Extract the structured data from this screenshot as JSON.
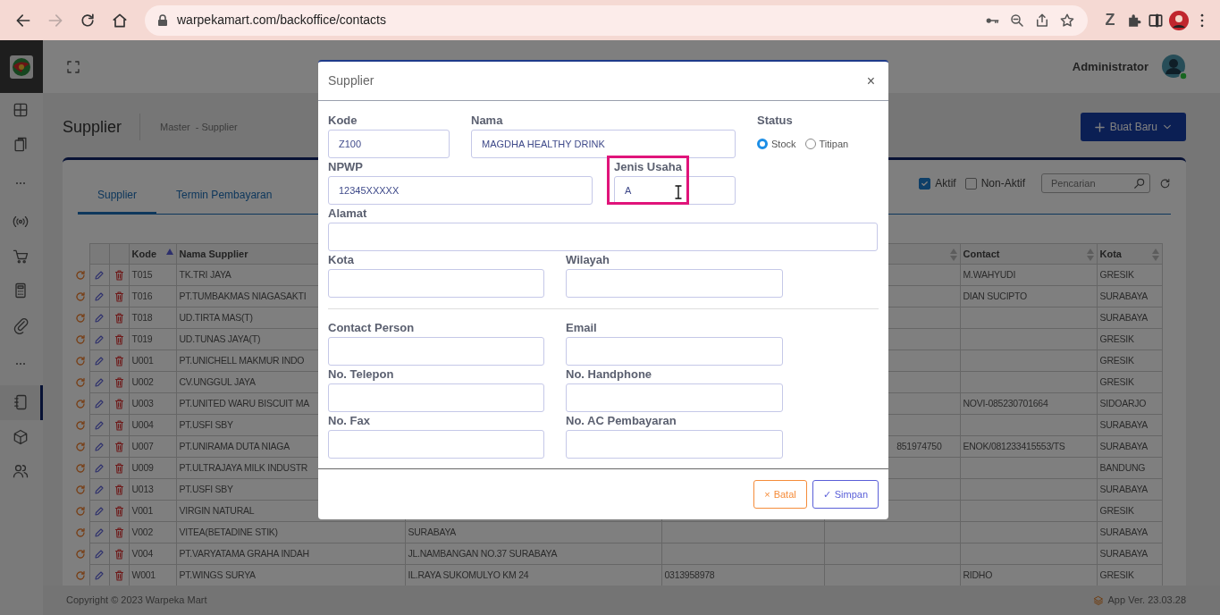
{
  "browser": {
    "nav_buttons": [
      {
        "kind": "back",
        "disabled": false
      },
      {
        "kind": "forward",
        "disabled": true
      },
      {
        "kind": "reload",
        "disabled": false
      },
      {
        "kind": "home",
        "disabled": false
      }
    ],
    "url": "warpekamart.com/backoffice/contacts",
    "extension_label": "Z"
  },
  "sidebar": {
    "items": [
      {
        "kind": "icon",
        "selected": false
      },
      {
        "kind": "icon",
        "selected": false
      },
      {
        "kind": "dots"
      },
      {
        "kind": "icon",
        "selected": false
      },
      {
        "kind": "icon",
        "selected": false
      },
      {
        "kind": "icon",
        "selected": false
      },
      {
        "kind": "icon",
        "selected": false
      },
      {
        "kind": "dots"
      },
      {
        "kind": "icon",
        "selected": true
      },
      {
        "kind": "icon",
        "selected": false
      },
      {
        "kind": "icon",
        "selected": false
      }
    ]
  },
  "header": {
    "user": "Administrator"
  },
  "page": {
    "title": "Supplier",
    "breadcrumb": [
      "Master",
      "-  Supplier"
    ],
    "new_button": "Buat Baru"
  },
  "tabs": [
    {
      "label": "Supplier",
      "selected": true
    },
    {
      "label": "Termin Pembayaran",
      "selected": false
    }
  ],
  "filters": [
    {
      "label": "Aktif",
      "checked": true
    },
    {
      "label": "Non-Aktif",
      "checked": false
    }
  ],
  "search": {
    "placeholder": "Pencarian"
  },
  "table": {
    "columns": [
      {
        "label": "Kode",
        "sortable": true,
        "sorted_ascending": true
      },
      {
        "label": "Nama Supplier"
      },
      {},
      {},
      {
        "sortable": true,
        "sorted_ascending": false
      },
      {
        "label": "Contact",
        "sortable": true,
        "sorted_ascending": false
      },
      {
        "label": "Kota",
        "sortable": true,
        "sorted_ascending": false
      }
    ],
    "rows": [
      {
        "kode": "T015",
        "nama": "TK.TRI JAYA",
        "contact": "M.WAHYUDI",
        "kota": "GRESIK"
      },
      {
        "kode": "T016",
        "nama": "PT.TUMBAKMAS NIAGASAKTI",
        "contact": "DIAN SUCIPTO",
        "kota": "SURABAYA"
      },
      {
        "kode": "T018",
        "nama": "UD.TIRTA MAS(T)",
        "kota": "SURABAYA"
      },
      {
        "kode": "T019",
        "nama": "UD.TUNAS JAYA(T)",
        "kota": "GRESIK"
      },
      {
        "kode": "U001",
        "nama": "PT.UNICHELL MAKMUR INDO",
        "kota": "GRESIK"
      },
      {
        "kode": "U002",
        "nama": "CV.UNGGUL JAYA",
        "kota": "GRESIK"
      },
      {
        "kode": "U003",
        "nama": "PT.UNITED WARU BISCUIT MA",
        "contact": "NOVI-085230701664",
        "kota": "SIDOARJO"
      },
      {
        "kode": "U004",
        "nama": "PT.USFI SBY",
        "kota": "SURABAYA"
      },
      {
        "kode": "U007",
        "nama": "PT.UNIRAMA DUTA NIAGA",
        "column_5": "851974750",
        "contact": "ENOK/081233415553/TS",
        "kota": "SURABAYA"
      },
      {
        "kode": "U009",
        "nama": "PT.ULTRAJAYA MILK INDUSTR",
        "kota": "BANDUNG"
      },
      {
        "kode": "U013",
        "nama": "PT.USFI SBY",
        "kota": "SURABAYA"
      },
      {
        "kode": "V001",
        "nama": "VIRGIN NATURAL",
        "kota": "GRESIK"
      },
      {
        "kode": "V002",
        "nama": "VITEA(BETADINE STIK)",
        "column_3": "SURABAYA",
        "kota": "SURABAYA"
      },
      {
        "kode": "V004",
        "nama": "PT.VARYATAMA GRAHA INDAH",
        "column_3": "JL.NAMBANGAN NO.37 SURABAYA",
        "kota": "SURABAYA"
      },
      {
        "kode": "W001",
        "nama": "PT.WINGS SURYA",
        "column_3": "IL.RAYA SUKOMULYO KM 24",
        "column_4": "0313958978",
        "contact": "RIDHO",
        "kota": "GRESIK"
      }
    ]
  },
  "footer": {
    "copyright": "Copyright © 2023 Warpeka Mart",
    "version": "App Ver. 23.03.28"
  },
  "modal": {
    "title": "Supplier",
    "close": "×",
    "sections": [
      [
        {
          "kind": "text",
          "label": "Kode",
          "value": "Z100",
          "highlighted": false,
          "hover": false
        },
        {
          "kind": "text",
          "label": "Nama",
          "value": "MAGDHA HEALTHY DRINK",
          "highlighted": false,
          "hover": false
        },
        {
          "kind": "radio",
          "label": "Status",
          "options": [
            {
              "label": "Stock",
              "selected": true
            },
            {
              "label": "Titipan",
              "selected": false
            }
          ]
        },
        {
          "kind": "text",
          "label": "NPWP",
          "value": "12345XXXXX",
          "highlighted": false,
          "hover": false
        },
        {
          "kind": "text",
          "label": "Jenis Usaha",
          "value": "A",
          "highlighted": true,
          "hover": true
        },
        {
          "kind": "text",
          "label": "Alamat",
          "highlighted": false,
          "hover": false
        },
        {
          "kind": "text",
          "label": "Kota",
          "highlighted": false,
          "hover": false
        },
        {
          "kind": "text",
          "label": "Wilayah",
          "highlighted": false,
          "hover": false
        }
      ],
      [
        {
          "kind": "text",
          "label": "Contact Person",
          "highlighted": false,
          "hover": false
        },
        {
          "kind": "text",
          "label": "Email",
          "highlighted": false,
          "hover": false
        },
        {
          "kind": "text",
          "label": "No. Telepon",
          "highlighted": false,
          "hover": false
        },
        {
          "kind": "text",
          "label": "No. Handphone",
          "highlighted": false,
          "hover": false
        },
        {
          "kind": "text",
          "label": "No. Fax",
          "highlighted": false,
          "hover": false
        },
        {
          "kind": "text",
          "label": "No. AC Pembayaran",
          "highlighted": false,
          "hover": false
        }
      ]
    ],
    "buttons": [
      {
        "kind": "cancel",
        "icon": "×",
        "label": "Batal"
      },
      {
        "kind": "save",
        "icon": "✓",
        "label": "Simpan"
      }
    ]
  }
}
